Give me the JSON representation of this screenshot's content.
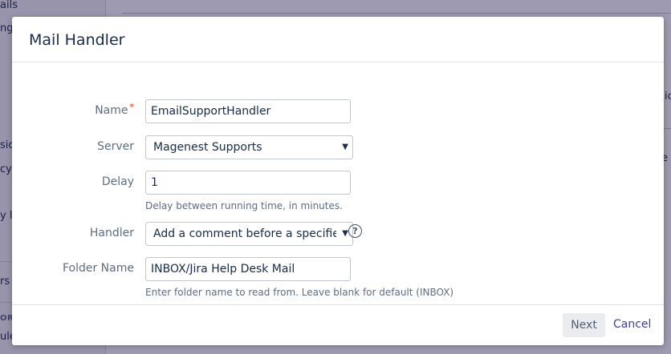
{
  "background": {
    "sidebar_items": [
      {
        "text": "ails"
      },
      {
        "text": "ng"
      },
      {
        "text": "sic"
      },
      {
        "text": "cy"
      },
      {
        "text": "y lo"
      },
      {
        "text": "rs"
      },
      {
        "text": "ule"
      }
    ],
    "sidebar_heading": "OR",
    "right_texts": [
      "ic",
      "e"
    ]
  },
  "modal": {
    "title": "Mail Handler",
    "fields": {
      "name": {
        "label": "Name",
        "value": "EmailSupportHandler",
        "required": "*"
      },
      "server": {
        "label": "Server",
        "value": "Magenest Supports"
      },
      "delay": {
        "label": "Delay",
        "value": "1",
        "help": "Delay between running time, in minutes."
      },
      "handler": {
        "label": "Handler",
        "value": "Add a comment before a specified"
      },
      "folder": {
        "label": "Folder Name",
        "value": "INBOX/Jira Help Desk Mail",
        "help": "Enter folder name to read from. Leave blank for default (INBOX)"
      }
    },
    "help_icon_glyph": "?",
    "dropdown_glyph": "▼",
    "footer": {
      "next_label": "Next",
      "cancel_label": "Cancel"
    }
  },
  "colors": {
    "overlay": "#170f46",
    "link": "#3b3ea8",
    "required": "#de350b"
  }
}
